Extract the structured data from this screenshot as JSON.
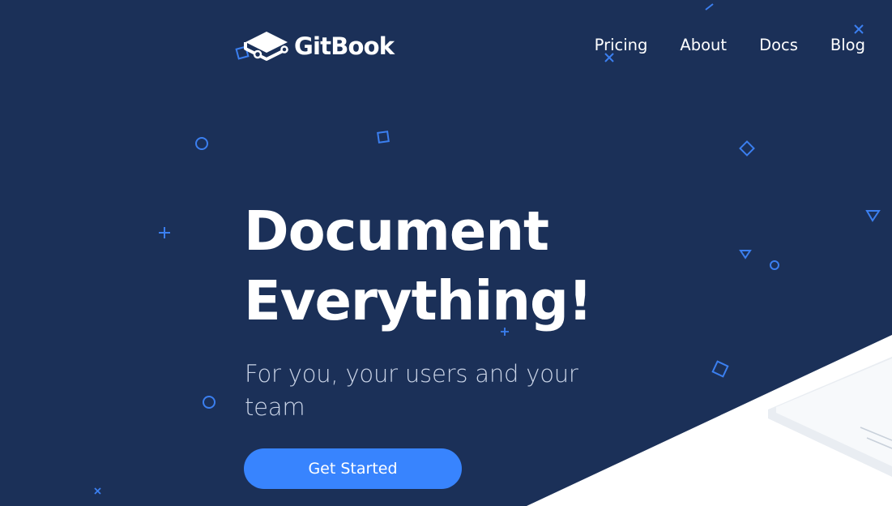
{
  "brand": {
    "name": "GitBook",
    "icon": "book-icon"
  },
  "nav": {
    "items": [
      {
        "label": "Pricing"
      },
      {
        "label": "About"
      },
      {
        "label": "Docs"
      },
      {
        "label": "Blog"
      }
    ]
  },
  "hero": {
    "title_line1": "Document",
    "title_line2": "Everything!",
    "subtitle": "For you, your users and your team",
    "cta_label": "Get Started"
  },
  "colors": {
    "background": "#1b3058",
    "accent": "#3884fe",
    "shape_stroke": "#3b7ff0",
    "text": "#ffffff",
    "subtitle": "#c9d3e6"
  }
}
